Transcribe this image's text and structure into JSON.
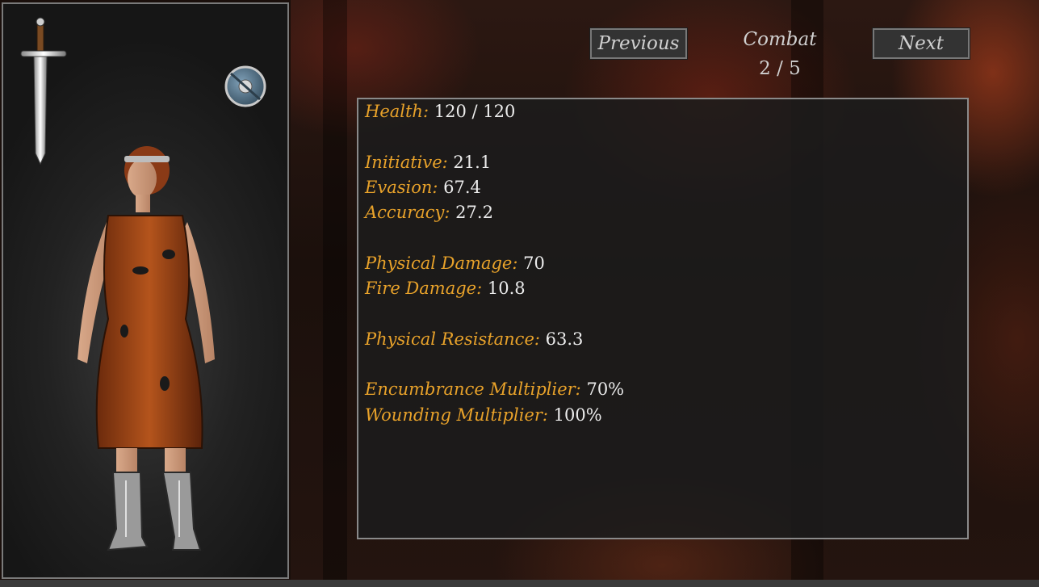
{
  "nav": {
    "previous_label": "Previous",
    "next_label": "Next",
    "page_title": "Combat",
    "page_counter": "2 / 5"
  },
  "equipment": {
    "weapon_icon": "sword-icon",
    "offhand_icon": "round-shield-icon",
    "character": "character-portrait"
  },
  "stats": {
    "health": {
      "label": "Health:",
      "value": "120 / 120"
    },
    "initiative": {
      "label": "Initiative:",
      "value": "21.1"
    },
    "evasion": {
      "label": "Evasion:",
      "value": "67.4"
    },
    "accuracy": {
      "label": "Accuracy:",
      "value": "27.2"
    },
    "physical_damage": {
      "label": "Physical Damage:",
      "value": "70"
    },
    "fire_damage": {
      "label": "Fire Damage:",
      "value": "10.8"
    },
    "physical_resistance": {
      "label": "Physical Resistance:",
      "value": "63.3"
    },
    "encumbrance_multiplier": {
      "label": "Encumbrance Multiplier:",
      "value": "70%"
    },
    "wounding_multiplier": {
      "label": "Wounding Multiplier:",
      "value": "100%"
    }
  },
  "colors": {
    "label": "#e8a22a",
    "value": "#ececec",
    "panel_border": "#8a8a8a"
  }
}
